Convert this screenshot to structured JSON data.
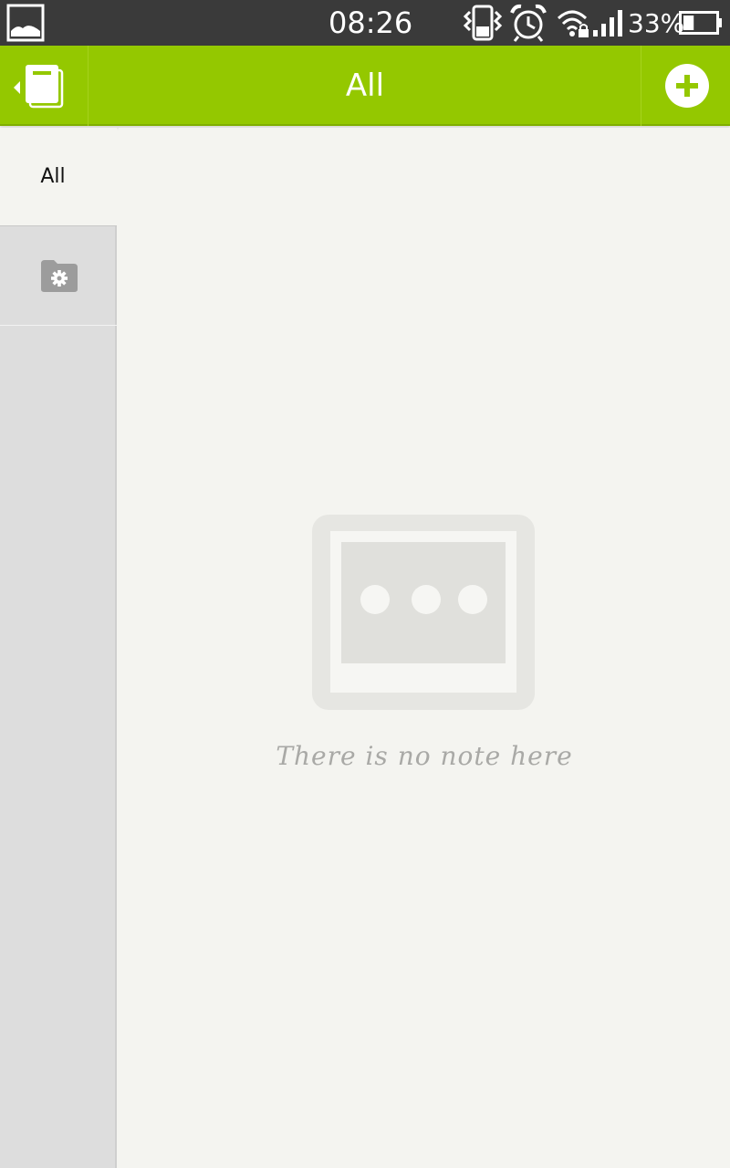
{
  "status_bar": {
    "time": "08:26",
    "battery_percent": "33%",
    "battery_level": 0.33,
    "icons": [
      "gallery-icon",
      "vibrate-icon",
      "alarm-icon",
      "wifi-lock-icon",
      "signal-icon",
      "battery-icon"
    ]
  },
  "app_bar": {
    "title": "All",
    "nav_icon": "notebook-drawer-icon",
    "add_icon": "add-circle-icon",
    "accent_color": "#94c800"
  },
  "sidebar": {
    "items": [
      {
        "label": "All"
      },
      {
        "icon": "folder-settings-icon"
      }
    ]
  },
  "main": {
    "empty_icon": "empty-note-icon",
    "empty_text": "There is no note here"
  }
}
